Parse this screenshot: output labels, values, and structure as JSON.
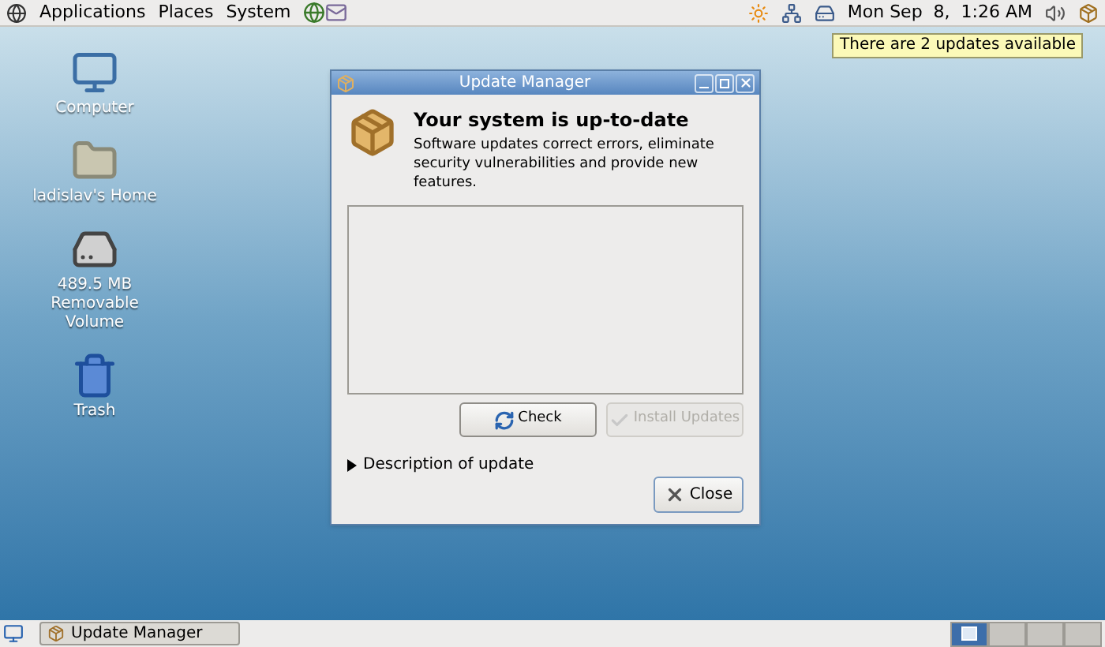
{
  "top_panel": {
    "menus": [
      {
        "label": "Applications"
      },
      {
        "label": "Places"
      },
      {
        "label": "System"
      }
    ],
    "clock": "Mon Sep  8,  1:26 AM",
    "tooltip": "There are 2 updates available"
  },
  "desktop_icons": [
    {
      "kind": "computer",
      "label": "Computer"
    },
    {
      "kind": "home",
      "label": "ladislav's Home"
    },
    {
      "kind": "drive",
      "label": "489.5 MB Removable Volume"
    },
    {
      "kind": "trash",
      "label": "Trash"
    }
  ],
  "window": {
    "title": "Update Manager",
    "heading": "Your system is up-to-date",
    "message": "Software updates correct errors, eliminate security vulnerabilities and provide new features.",
    "buttons": [
      {
        "kind": "check",
        "label": "Check",
        "disabled": false
      },
      {
        "kind": "install",
        "label": "Install Updates",
        "disabled": true
      }
    ],
    "expander": {
      "label": "Description of update",
      "expanded": false
    },
    "close_button": "Close"
  },
  "bottom_panel": {
    "tasks": [
      {
        "label": "Update Manager"
      }
    ],
    "workspaces": [
      {
        "selected": true
      },
      {
        "selected": false
      },
      {
        "selected": false
      },
      {
        "selected": false
      }
    ]
  }
}
